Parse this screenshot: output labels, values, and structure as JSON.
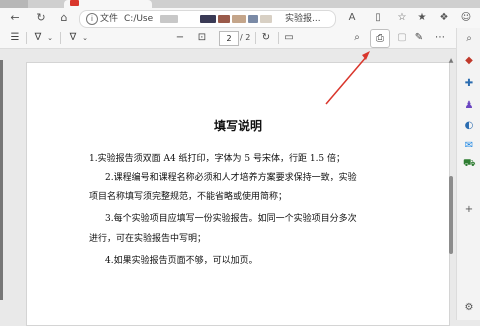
{
  "browser": {
    "address_scheme": "文件",
    "address_path": "C:/Use",
    "address_tail": "实验报..."
  },
  "pdf_toolbar": {
    "current_page": "2",
    "page_total": "/ 2"
  },
  "document": {
    "title": "填写说明",
    "lines": [
      "1.实验报告须双面 A4 纸打印，字体为 5 号宋体，行距 1.5 倍；",
      "2.课程编号和课程名称必须和人才培养方案要求保持一致，实验",
      "项目名称填写须完整规范，不能省略或使用简称；",
      "3.每个实验项目应填写一份实验报告。如同一个实验项目分多次",
      "进行，可在实验报告中写明；",
      "4.如果实验报告页面不够，可以加页。"
    ]
  },
  "colors": {
    "annotation_arrow": "#d9362c"
  }
}
